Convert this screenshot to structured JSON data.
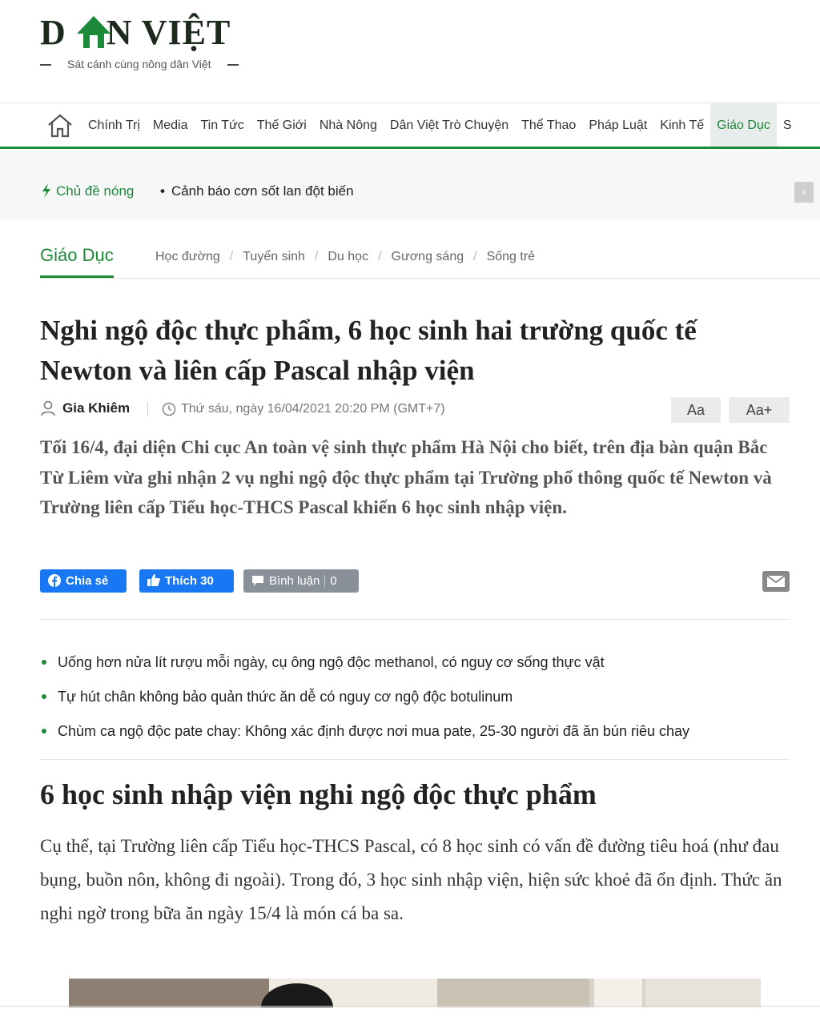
{
  "header": {
    "logo_left": "D",
    "logo_right": "N VIỆT",
    "tagline": "Sát cánh cùng nông dân Việt"
  },
  "nav": {
    "items": [
      "Chính Trị",
      "Media",
      "Tin Tức",
      "Thế Giới",
      "Nhà Nông",
      "Dân Việt Trò Chuyện",
      "Thể Thao",
      "Pháp Luật",
      "Kinh Tế",
      "Giáo Dục",
      "S"
    ],
    "active": "Giáo Dục"
  },
  "hot": {
    "label": "Chủ đề nóng",
    "item": "Cảnh báo cơn sốt lan đột biến"
  },
  "category": {
    "main": "Giáo Dục",
    "subs": [
      "Học đường",
      "Tuyển sinh",
      "Du học",
      "Gương sáng",
      "Sống trẻ"
    ]
  },
  "article": {
    "title": "Nghi ngộ độc thực phẩm, 6 học sinh hai trường quốc tế Newton và liên cấp Pascal nhập viện",
    "author": "Gia Khiêm",
    "date": "Thứ sáu, ngày 16/04/2021 20:20 PM (GMT+7)",
    "font_small": "Aa",
    "font_large": "Aa+",
    "sapo": "Tối 16/4, đại diện Chi cục An toàn vệ sinh thực phẩm Hà Nội cho biết, trên địa bàn quận Bắc Từ Liêm vừa ghi nhận 2 vụ nghi ngộ độc thực phẩm tại Trường phổ thông quốc tế Newton và Trường liên cấp Tiểu học-THCS Pascal khiến 6 học sinh nhập viện.",
    "heading": "6 học sinh nhập viện nghi ngộ độc thực phẩm",
    "paragraph": "Cụ thể, tại Trường liên cấp Tiểu học-THCS Pascal, có 8 học sinh có vấn đề đường tiêu hoá (như đau bụng, buồn nôn, không đi ngoài). Trong đó, 3 học sinh nhập viện, hiện sức khoẻ đã ổn định. Thức ăn nghi ngờ trong bữa ăn ngày 15/4 là món cá ba sa."
  },
  "social": {
    "share_label": "Chia sẻ",
    "like_label": "Thích 30",
    "comment_label": "Bình luận",
    "comment_count": "0"
  },
  "related": [
    "Uống hơn nửa lít rượu mỗi ngày, cụ ông ngộ độc methanol, có nguy cơ sống thực vật",
    "Tự hút chân không bảo quản thức ăn dễ có nguy cơ ngộ độc botulinum",
    "Chùm ca ngộ độc pate chay: Không xác định được nơi mua pate, 25-30 người đã ăn bún riêu chay"
  ],
  "colors": {
    "brand_green": "#1d8a3a",
    "facebook_blue": "#1877f2",
    "comment_gray": "#8a9099"
  },
  "icons": {
    "home": "home-icon",
    "bolt": "lightning-icon",
    "prev": "chevron-left-icon",
    "author": "user-icon",
    "clock": "clock-icon",
    "facebook": "facebook-icon",
    "thumb": "thumbs-up-icon",
    "comment": "comment-icon",
    "mail": "mail-icon"
  }
}
